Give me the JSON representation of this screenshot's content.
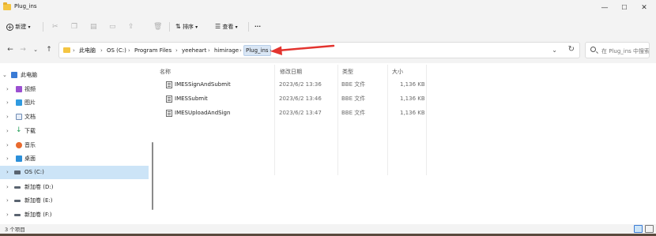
{
  "window": {
    "title": "Plug_ins"
  },
  "window_controls": {
    "minimize": "—",
    "maximize": "☐",
    "close": "✕"
  },
  "commandbar": {
    "new_label": "新建",
    "sort_label": "排序",
    "view_label": "查看",
    "more_label": "···"
  },
  "breadcrumb": {
    "root": "此电脑",
    "items": [
      "OS (C:)",
      "Program Files",
      "yeeheart",
      "himirage",
      "Plug_ins"
    ]
  },
  "search": {
    "placeholder": "在 Plug_ins 中搜索"
  },
  "sidebar": {
    "items": [
      {
        "label": "此电脑",
        "icon": "computer-icon"
      },
      {
        "label": "视频",
        "icon": "video-icon"
      },
      {
        "label": "图片",
        "icon": "picture-icon"
      },
      {
        "label": "文档",
        "icon": "document-icon"
      },
      {
        "label": "下载",
        "icon": "download-icon"
      },
      {
        "label": "音乐",
        "icon": "music-icon"
      },
      {
        "label": "桌面",
        "icon": "desktop-icon"
      },
      {
        "label": "OS (C:)",
        "icon": "drive-icon"
      },
      {
        "label": "新加卷 (D:)",
        "icon": "drive-icon"
      },
      {
        "label": "新加卷 (E:)",
        "icon": "drive-icon"
      },
      {
        "label": "新加卷 (F:)",
        "icon": "drive-icon"
      }
    ],
    "selected": "OS (C:)"
  },
  "columns": {
    "name": "名称",
    "modified": "修改日期",
    "type": "类型",
    "size": "大小"
  },
  "files": [
    {
      "name": "IMESSignAndSubmit",
      "modified": "2023/6/2 13:36",
      "type": "BBE 文件",
      "size": "1,136 KB"
    },
    {
      "name": "IMESSubmit",
      "modified": "2023/6/2 13:46",
      "type": "BBE 文件",
      "size": "1,136 KB"
    },
    {
      "name": "IMESUploadAndSign",
      "modified": "2023/6/2 13:47",
      "type": "BBE 文件",
      "size": "1,136 KB"
    }
  ],
  "status": {
    "item_count": "3 个项目"
  },
  "colors": {
    "accent": "#0067c0",
    "selection": "#cce4f7",
    "annotation_arrow": "#e3342f",
    "folder": "#f4c542"
  }
}
